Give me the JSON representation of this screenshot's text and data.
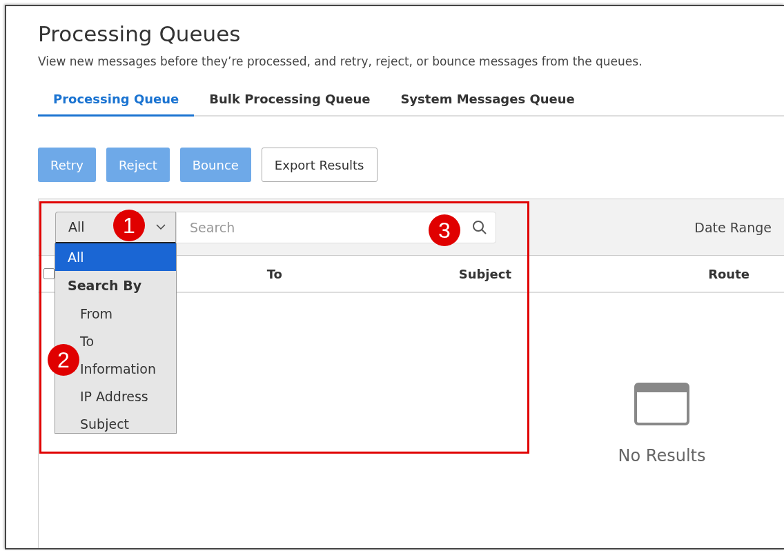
{
  "page": {
    "title": "Processing Queues",
    "description": "View new messages before they’re processed, and retry, reject, or bounce messages from the queues."
  },
  "tabs": [
    {
      "label": "Processing Queue",
      "selected": true
    },
    {
      "label": "Bulk Processing Queue",
      "selected": false
    },
    {
      "label": "System Messages Queue",
      "selected": false
    }
  ],
  "actions": [
    {
      "label": "Retry",
      "kind": "primary"
    },
    {
      "label": "Reject",
      "kind": "primary"
    },
    {
      "label": "Bounce",
      "kind": "primary"
    },
    {
      "label": "Export Results",
      "kind": "secondary"
    }
  ],
  "filter": {
    "select_value": "All",
    "search": {
      "placeholder": "Search"
    },
    "date_range_label": "Date Range"
  },
  "dropdown": {
    "options": [
      {
        "label": "All",
        "kind": "option",
        "selected": true
      },
      {
        "label": "Search By",
        "kind": "group"
      },
      {
        "label": "From",
        "kind": "option",
        "selected": false
      },
      {
        "label": "To",
        "kind": "option",
        "selected": false
      },
      {
        "label": "Information",
        "kind": "option",
        "selected": false
      },
      {
        "label": "IP Address",
        "kind": "option",
        "selected": false
      },
      {
        "label": "Subject",
        "kind": "option",
        "selected": false
      }
    ]
  },
  "table": {
    "select_all": {
      "checked": false
    },
    "columns": [
      "To",
      "Subject",
      "Route"
    ]
  },
  "empty_state": {
    "message": "No Results"
  },
  "annotations": [
    {
      "label": "1"
    },
    {
      "label": "2"
    },
    {
      "label": "3"
    }
  ]
}
